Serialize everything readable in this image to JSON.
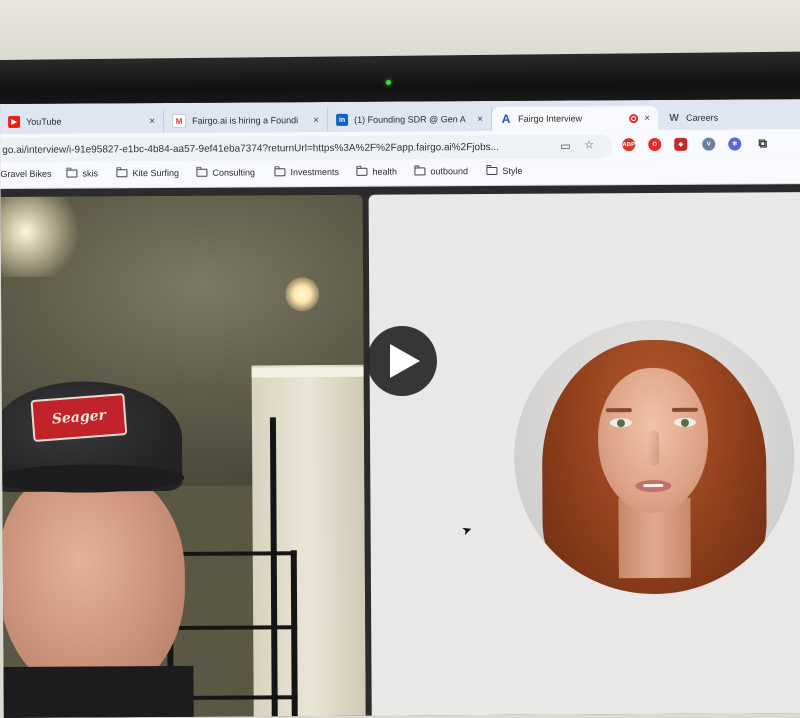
{
  "browser": {
    "tabs": [
      {
        "title": "YouTube",
        "favicon": "youtube-icon",
        "close": "×"
      },
      {
        "title": "Fairgo.ai is hiring a Foundi",
        "favicon": "gmail-icon",
        "close": "×"
      },
      {
        "title": "(1) Founding SDR @ Gen A",
        "favicon": "linkedin-icon",
        "close": "×"
      },
      {
        "title": "Fairgo Interview",
        "favicon": "fairgo-icon",
        "close": "×",
        "active": true,
        "recording": true
      },
      {
        "title": "Careers",
        "favicon": "w-icon"
      }
    ],
    "url": "go.ai/interview/i-91e95827-e1bc-4b84-aa57-9ef41eba7374?returnUrl=https%3A%2F%2Fapp.fairgo.ai%2Fjobs...",
    "bookmarks": [
      {
        "label": "Gravel Bikes",
        "folder": false
      },
      {
        "label": "skis",
        "folder": true
      },
      {
        "label": "Kite Surfing",
        "folder": true
      },
      {
        "label": "Consulting",
        "folder": true
      },
      {
        "label": "Investments",
        "folder": true
      },
      {
        "label": "health",
        "folder": true
      },
      {
        "label": "outbound",
        "folder": true
      },
      {
        "label": "Style",
        "folder": true
      }
    ],
    "extensions": [
      "abp-icon",
      "opera-icon",
      "shield-icon",
      "vpn-icon",
      "gear-icon",
      "puzzle-icon"
    ]
  },
  "page": {
    "cap_text": "Seager"
  },
  "colors": {
    "tab_bar": "#dfe6f1",
    "toolbar": "#f7f9fc",
    "avatar_bg": "#eae8e6",
    "play_overlay": "#262626"
  }
}
